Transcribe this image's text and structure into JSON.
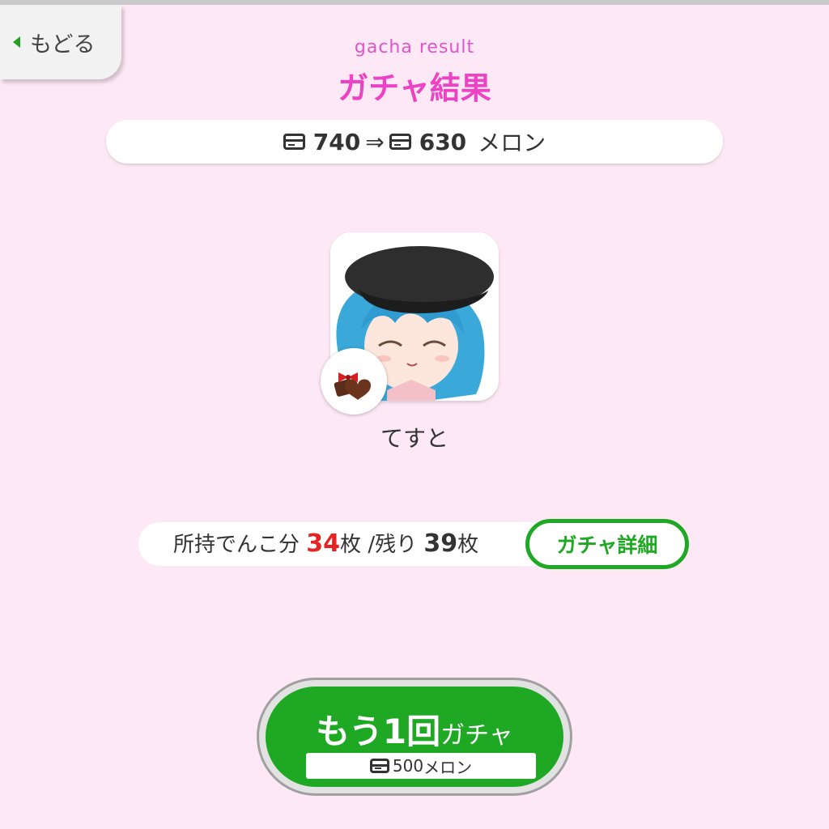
{
  "header": {
    "back_label": "もどる",
    "subtitle": "gacha result",
    "title": "ガチャ結果"
  },
  "balance": {
    "before": "740",
    "arrow": "⇒",
    "after": "630",
    "unit": "メロン",
    "icon": "credit-card-icon"
  },
  "result": {
    "item_name": "てすと",
    "badge_icon": "chocolate-gift-icon",
    "portrait": "character-portrait"
  },
  "ownership": {
    "prefix": "所持でんこ分",
    "owned": "34",
    "owned_unit": "枚",
    "remaining_label": "/残り",
    "remaining": "39",
    "remaining_unit": "枚"
  },
  "detail_button": {
    "label": "ガチャ詳細"
  },
  "again_button": {
    "main": "もう1回",
    "suffix": "ガチャ",
    "cost": "500",
    "cost_unit": "メロン"
  },
  "colors": {
    "background": "#fde8f5",
    "title": "#ec42c4",
    "accent_green": "#1ea824",
    "highlight_red": "#e62222"
  }
}
